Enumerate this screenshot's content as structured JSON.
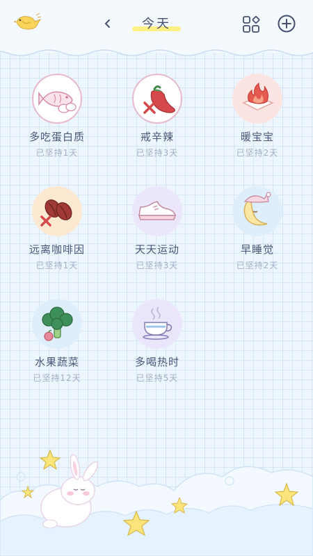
{
  "header": {
    "title": "今天",
    "back_icon": "chevron-left-icon",
    "grid_icon": "grid-icon",
    "add_icon": "plus-circle-icon"
  },
  "colors": {
    "background": "#eef6fd",
    "title_highlight": "#fcef86",
    "text_primary": "#4b5677",
    "text_secondary": "#a4aec4"
  },
  "habits": [
    {
      "name": "多吃蛋白质",
      "days": "已坚持1天",
      "icon": "fish-egg-icon",
      "bg": "#fbeef3"
    },
    {
      "name": "戒辛辣",
      "days": "已坚持3天",
      "icon": "no-chili-icon",
      "bg": "#fbeef3"
    },
    {
      "name": "暖宝宝",
      "days": "已坚持2天",
      "icon": "fire-warmer-icon",
      "bg": "#fbe4e1"
    },
    {
      "name": "远离咖啡因",
      "days": "已坚持1天",
      "icon": "no-coffee-icon",
      "bg": "#fde9d2"
    },
    {
      "name": "天天运动",
      "days": "已坚持3天",
      "icon": "sneaker-icon",
      "bg": "#ebe6fb"
    },
    {
      "name": "早睡觉",
      "days": "已坚持2天",
      "icon": "moon-sleep-icon",
      "bg": "#dfeefb"
    },
    {
      "name": "水果蔬菜",
      "days": "已坚持12天",
      "icon": "broccoli-icon",
      "bg": "#dfeefb"
    },
    {
      "name": "多喝热时",
      "days": "已坚持5天",
      "icon": "hot-tea-icon",
      "bg": "#ebe6fb"
    }
  ]
}
